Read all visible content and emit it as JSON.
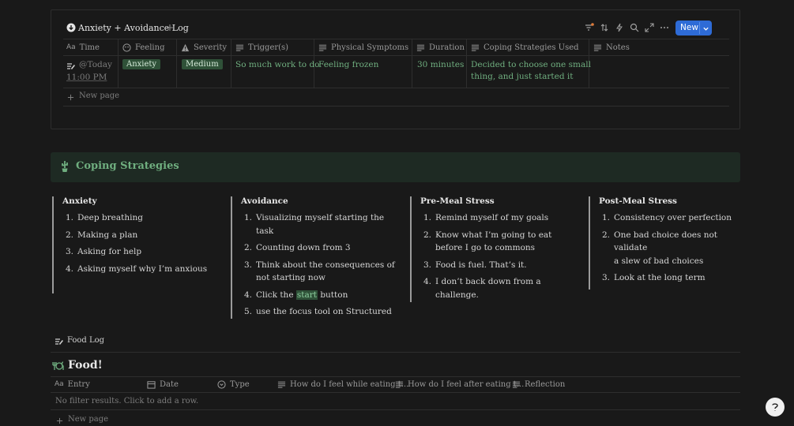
{
  "db": {
    "title": "Anxiety + Avoidance Log",
    "add_icon": "plus-icon",
    "new_button": "New",
    "columns": {
      "time": "Time",
      "feeling": "Feeling",
      "severity": "Severity",
      "triggers": "Trigger(s)",
      "physical": "Physical Symptoms",
      "duration": "Duration",
      "coping": "Coping Strategies Used",
      "notes": "Notes"
    },
    "row": {
      "time_line1": "@Today",
      "time_line2": "11:00 PM",
      "feeling": "Anxiety",
      "severity": "Medium",
      "triggers": "So much work to do",
      "physical": "Feeling frozen",
      "duration": "30 minutes",
      "coping_line1": "Decided to choose one small",
      "coping_line2": "thing, and just started it"
    },
    "new_page": "New page",
    "accent_color": "#2e6bd6"
  },
  "callout": {
    "title": "Coping Strategies",
    "icon": "cactus-icon",
    "bg": "#1e2a23"
  },
  "columns": [
    {
      "heading": "Anxiety",
      "items": [
        {
          "n": "1.",
          "lines": [
            "Deep breathing"
          ]
        },
        {
          "n": "2.",
          "lines": [
            "Making a plan"
          ]
        },
        {
          "n": "3.",
          "lines": [
            "Asking for help"
          ]
        },
        {
          "n": "4.",
          "lines": [
            "Asking myself why I’m anxious"
          ]
        }
      ]
    },
    {
      "heading": "Avoidance",
      "items": [
        {
          "n": "1.",
          "lines": [
            "Visualizing myself starting the",
            "task"
          ]
        },
        {
          "n": "2.",
          "lines": [
            "Counting down from 3"
          ]
        },
        {
          "n": "3.",
          "lines": [
            "Think about the consequences of",
            "not starting now"
          ]
        },
        {
          "n": "4.",
          "pre": "Click the ",
          "hl": "start",
          "post": " button"
        },
        {
          "n": "5.",
          "lines": [
            "use the focus tool on Structured"
          ]
        }
      ]
    },
    {
      "heading": "Pre-Meal Stress",
      "items": [
        {
          "n": "1.",
          "lines": [
            "Remind myself of my goals"
          ]
        },
        {
          "n": "2.",
          "lines": [
            "Know what I’m going to eat",
            "before I go to commons"
          ]
        },
        {
          "n": "3.",
          "lines": [
            "Food is fuel. That’s it."
          ]
        },
        {
          "n": "4.",
          "lines": [
            "I don’t back down from a",
            "challenge."
          ]
        }
      ]
    },
    {
      "heading": "Post-Meal Stress",
      "items": [
        {
          "n": "1.",
          "lines": [
            "Consistency over perfection"
          ]
        },
        {
          "n": "2.",
          "lines": [
            "One bad choice does not validate",
            "a slew of bad choices"
          ]
        },
        {
          "n": "3.",
          "lines": [
            "Look at the long term"
          ]
        }
      ]
    }
  ],
  "food_log_link": "Food Log",
  "food": {
    "title": "Food!",
    "columns": {
      "entry": "Entry",
      "date": "Date",
      "type": "Type",
      "while": "How do I feel while eating t...",
      "after": "How do I feel after eating t...",
      "reflection": "Reflection"
    },
    "empty": "No filter results. Click to add a row.",
    "new_page": "New page"
  },
  "help_icon": "help-icon"
}
